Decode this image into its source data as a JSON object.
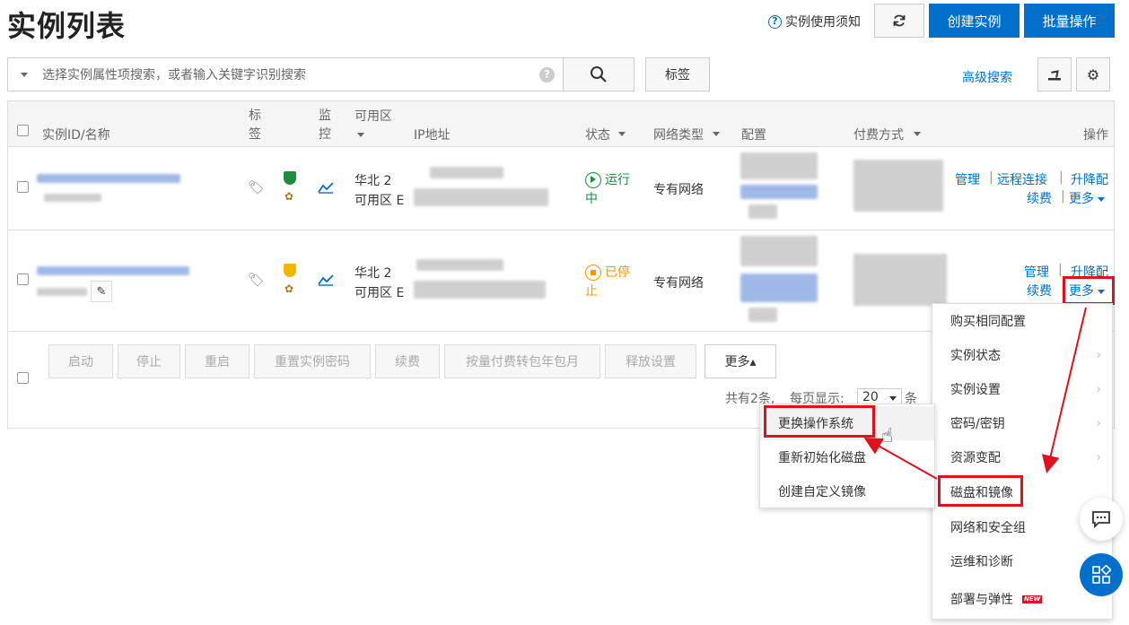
{
  "page": {
    "title": "实例列表",
    "notice": "实例使用须知",
    "create_button": "创建实例",
    "batch_button": "批量操作"
  },
  "search": {
    "placeholder": "选择实例属性项搜索，或者输入关键字识别搜索",
    "tag_button": "标签",
    "advanced": "高级搜索"
  },
  "table": {
    "headers": {
      "id_name": "实例ID/名称",
      "tag": "标签",
      "monitor": "监控",
      "zone": "可用区",
      "ip": "IP地址",
      "status": "状态",
      "network": "网络类型",
      "config": "配置",
      "payment": "付费方式",
      "action": "操作"
    },
    "rows": [
      {
        "zone_line1": "华北 2",
        "zone_line2": "可用区 E",
        "status": "运行中",
        "status_color": "#1e8e3e",
        "network": "专有网络",
        "actions": {
          "manage": "管理",
          "remote": "远程连接",
          "resize": "升降配",
          "renew": "续费",
          "more": "更多"
        }
      },
      {
        "zone_line1": "华北 2",
        "zone_line2": "可用区 E",
        "status": "已停止",
        "status_color": "#f39800",
        "network": "专有网络",
        "actions": {
          "manage": "管理",
          "resize": "升降配",
          "renew": "续费",
          "more": "更多"
        }
      }
    ]
  },
  "batch": {
    "start": "启动",
    "stop": "停止",
    "restart": "重启",
    "reset_password": "重置实例密码",
    "renew": "续费",
    "convert": "按量付费转包年包月",
    "release": "释放设置",
    "more": "更多▴"
  },
  "pagination": {
    "total": "共有2条,",
    "per_page_label": "每页显示:",
    "per_page_value": "20",
    "unit": "条"
  },
  "more_menu": {
    "items": [
      "购买相同配置",
      "实例状态",
      "实例设置",
      "密码/密钥",
      "资源变配",
      "磁盘和镜像",
      "网络和安全组",
      "运维和诊断",
      "部署与弹性"
    ],
    "new_badge": "NEW"
  },
  "disk_submenu": {
    "items": [
      "更换操作系统",
      "重新初始化磁盘",
      "创建自定义镜像"
    ]
  },
  "colors": {
    "primary": "#0070cc",
    "highlight": "#e0111d"
  }
}
